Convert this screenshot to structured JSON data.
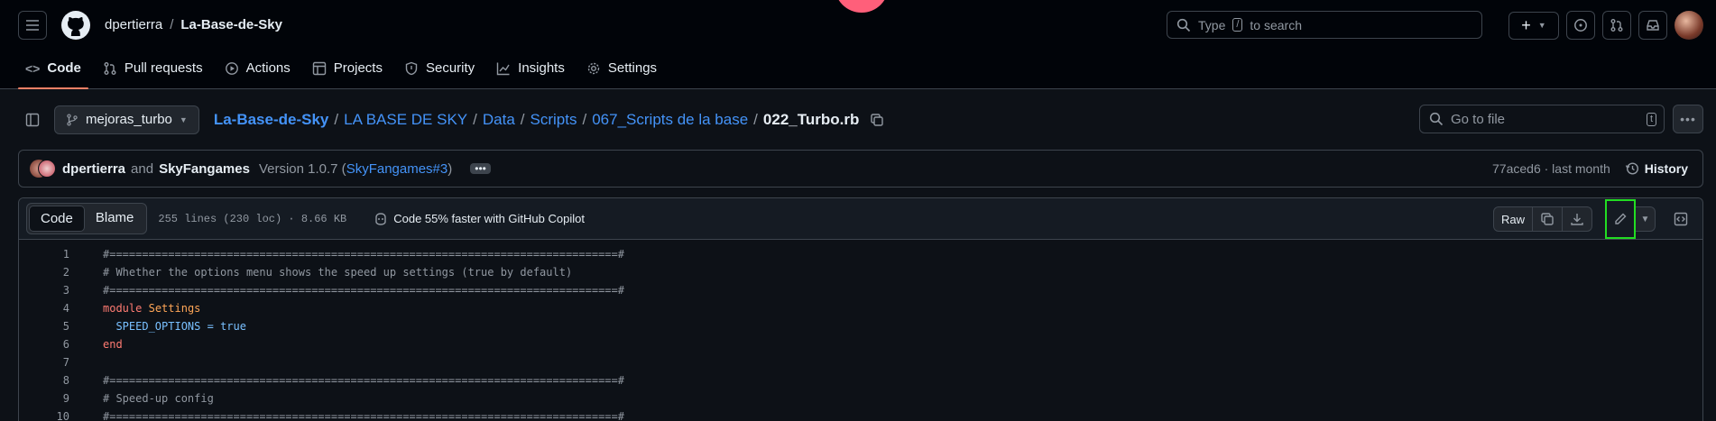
{
  "header": {
    "owner": "dpertierra",
    "separator": "/",
    "repo": "La-Base-de-Sky",
    "search_prefix": "Type",
    "search_key": "/",
    "search_suffix": "to search"
  },
  "repo_nav": {
    "tabs": [
      {
        "label": "Code",
        "icon": "code-icon"
      },
      {
        "label": "Pull requests",
        "icon": "pull-request-icon"
      },
      {
        "label": "Actions",
        "icon": "play-icon"
      },
      {
        "label": "Projects",
        "icon": "table-icon"
      },
      {
        "label": "Security",
        "icon": "shield-icon"
      },
      {
        "label": "Insights",
        "icon": "graph-icon"
      },
      {
        "label": "Settings",
        "icon": "gear-icon"
      }
    ]
  },
  "filebar": {
    "branch": "mejoras_turbo",
    "crumbs": [
      "La-Base-de-Sky",
      "LA BASE DE SKY",
      "Data",
      "Scripts",
      "067_Scripts de la base"
    ],
    "file": "022_Turbo.rb",
    "goto_placeholder": "Go to file",
    "goto_key": "t"
  },
  "commit": {
    "author1": "dpertierra",
    "and": "and",
    "author2": "SkyFangames",
    "message": "Version 1.0.7 (",
    "ref": "SkyFangames#3",
    "close": ")",
    "ellipsis": "•••",
    "sha": "77aced6 · last month",
    "history": "History"
  },
  "code_header": {
    "tab_code": "Code",
    "tab_blame": "Blame",
    "info": "255 lines (230 loc) · 8.66 KB",
    "copilot": "Code 55% faster with GitHub Copilot",
    "raw": "Raw"
  },
  "code_lines": [
    {
      "n": "1",
      "text": "#==============================================================================#"
    },
    {
      "n": "2",
      "text": "# Whether the options menu shows the speed up settings (true by default)"
    },
    {
      "n": "3",
      "text": "#==============================================================================#"
    },
    {
      "n": "4",
      "kw": "module",
      "name": "Settings"
    },
    {
      "n": "5",
      "const": "SPEED_OPTIONS",
      "eq": " = ",
      "val": "true"
    },
    {
      "n": "6",
      "end": "end"
    },
    {
      "n": "7",
      "text": ""
    },
    {
      "n": "8",
      "text": "#==============================================================================#"
    },
    {
      "n": "9",
      "text": "# Speed-up config"
    },
    {
      "n": "10",
      "text": "#==============================================================================#"
    }
  ]
}
